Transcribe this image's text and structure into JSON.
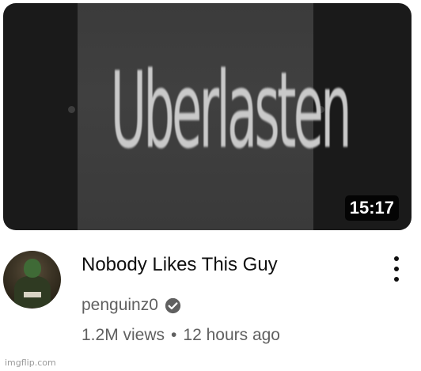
{
  "thumbnail": {
    "text": "Uberlasten",
    "duration": "15:17"
  },
  "video": {
    "title": "Nobody Likes This Guy",
    "channel": "penguinz0",
    "views": "1.2M views",
    "separator": "•",
    "age": "12 hours ago"
  },
  "icons": {
    "verified": "verified-check-icon",
    "menu": "more-vert-icon"
  },
  "watermark": "imgflip.com"
}
